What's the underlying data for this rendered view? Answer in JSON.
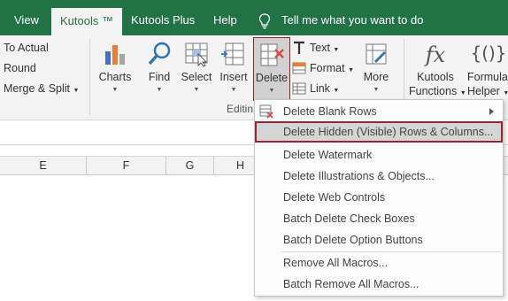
{
  "tabs": {
    "view": "View",
    "kutools": "Kutools ™",
    "kutools_plus": "Kutools Plus",
    "help": "Help",
    "tell_me": "Tell me what you want to do"
  },
  "ribbon": {
    "small_left": [
      "To Actual",
      "Round",
      "Merge & Split"
    ],
    "buttons": {
      "charts": "Charts",
      "find": "Find",
      "select": "Select",
      "insert": "Insert",
      "delete": "Delete",
      "more": "More",
      "kutools_functions_1": "Kutools",
      "kutools_functions_2": "Functions",
      "formula_helper_1": "Formula",
      "formula_helper_2": "Helper"
    },
    "text_items": {
      "text": "Text",
      "format": "Format",
      "link": "Link"
    },
    "group_label": "Editin"
  },
  "columns": [
    "E",
    "F",
    "G",
    "H"
  ],
  "menu": {
    "items": [
      "Delete Blank Rows",
      "Delete Hidden (Visible) Rows & Columns...",
      "Delete Watermark",
      "Delete Illustrations & Objects...",
      "Delete Web Controls",
      "Batch Delete Check Boxes",
      "Batch Delete Option Buttons",
      "Remove All Macros...",
      "Batch Remove All Macros..."
    ],
    "highlighted": "Delete Hidden (Visible) Rows & Columns..."
  },
  "colors": {
    "brand": "#217346",
    "highlight_border": "#9b2333",
    "ribbon_bg": "#f3f3f3"
  }
}
